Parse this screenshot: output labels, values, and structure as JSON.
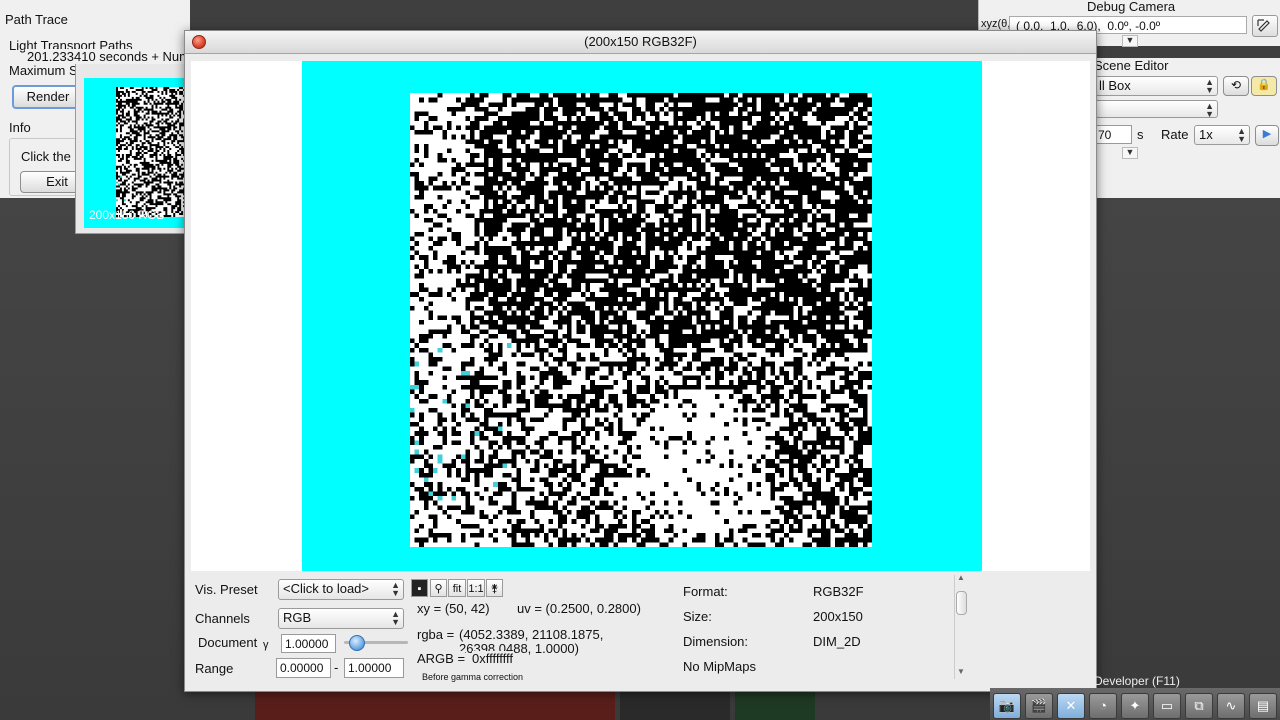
{
  "path_trace": {
    "title": "Path Trace",
    "light_transport_label": "Light Transport Paths",
    "time_text": "201.233410 seconds + Num",
    "max_label": "Maximum S",
    "render_button": "Render",
    "info_label": "Info",
    "click_text": "Click the",
    "exit_button": "Exit",
    "thumbnail_label": "200x150 RGB"
  },
  "debug_camera": {
    "title": "Debug Camera",
    "xyz_label": "xyz(θ,φ,ψ)",
    "value": "( 0.0,  1.0,  6.0),  0.0º, -0.0º"
  },
  "scene_editor": {
    "title": "Scene Editor",
    "scene_select": "ll Box",
    "second_select": "",
    "time_value": "70",
    "time_unit": "s",
    "rate_label": "Rate",
    "rate_value": "1x"
  },
  "viewer": {
    "title": "(200x150 RGB32F)",
    "vis_preset_label": "Vis. Preset",
    "vis_preset_value": "<Click to load>",
    "channels_label": "Channels",
    "channels_value": "RGB",
    "document_label": "Document",
    "gamma_symbol": "γ",
    "gamma_value": "1.00000",
    "range_label": "Range",
    "range_min": "0.00000",
    "range_dash": "-",
    "range_max": "1.00000",
    "tools": {
      "fit": "fit",
      "one_to_one": "1:1"
    },
    "xy_label": "xy = (50, 42)",
    "uv_label": "uv = (0.2500, 0.2800)",
    "rgba_label": "rgba =",
    "rgba_value_line1": "(4052.3389, 21108.1875,",
    "rgba_value_line2": "26398.0488, 1.0000)",
    "argb_label": "ARGB =",
    "argb_value": "0xffffffff",
    "gamma_note": "Before gamma correction",
    "format_label": "Format:",
    "format_value": "RGB32F",
    "size_label": "Size:",
    "size_value": "200x150",
    "dimension_label": "Dimension:",
    "dimension_value": "DIM_2D",
    "mipmaps_label": "No MipMaps"
  },
  "developer": {
    "label": "Developer (F11)"
  },
  "colors": {
    "cyan_background": "#00ffff",
    "noise_dark": "#000000",
    "noise_light": "#ffffff",
    "accent_cyan_pixel": "#3fd0d8"
  }
}
